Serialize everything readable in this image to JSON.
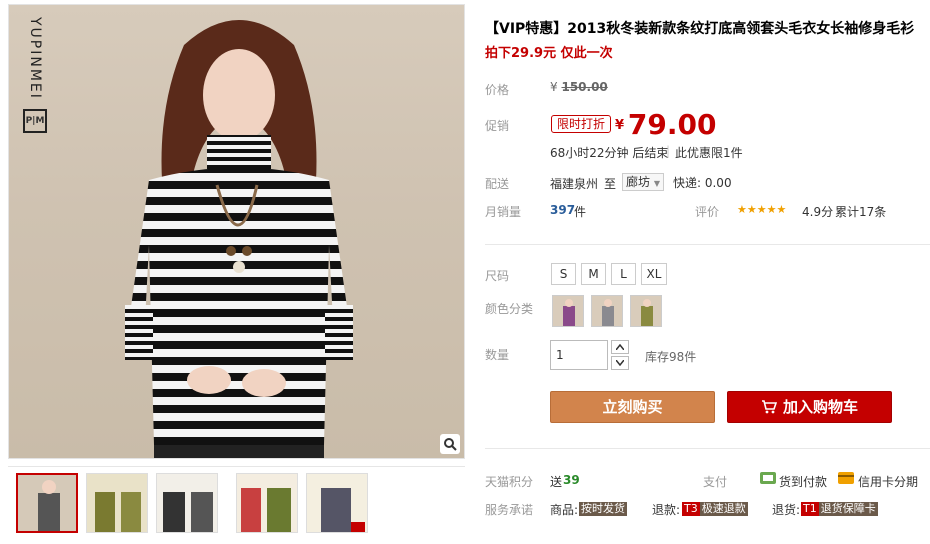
{
  "brand": {
    "name": "YUPINMEI",
    "mark": "P|M"
  },
  "product": {
    "title": "【VIP特惠】2013秋冬装新款条纹打底高领套头毛衣女长袖修身毛衫",
    "subtitle": "拍下29.9元 仅此一次"
  },
  "price": {
    "label": "价格",
    "currency": "¥",
    "original": "150.00"
  },
  "promo": {
    "label": "促销",
    "tag": "限时打折",
    "currency": "¥",
    "price": "79.00",
    "countdown": "68小时22分钟 后结束",
    "limit": "此优惠限1件"
  },
  "shipping": {
    "label": "配送",
    "from": "福建泉州",
    "to_word": "至",
    "to": "廊坊",
    "fee": "快递: 0.00"
  },
  "sales": {
    "label": "月销量",
    "count": "397",
    "unit": "件",
    "rating_label": "评价",
    "stars": "★★★★★",
    "score": "4.9分",
    "reviews": "累计17条"
  },
  "size": {
    "label": "尺码",
    "options": [
      "S",
      "M",
      "L",
      "XL"
    ]
  },
  "color": {
    "label": "颜色分类",
    "options": [
      "purple-swatch",
      "gray-swatch",
      "olive-swatch"
    ],
    "colors": [
      "#8a4a8a",
      "#8a8a90",
      "#8a8a40"
    ]
  },
  "quantity": {
    "label": "数量",
    "value": "1",
    "stock": "库存98件"
  },
  "actions": {
    "buy": "立刻购买",
    "cart": "加入购物车"
  },
  "points": {
    "label": "天猫积分",
    "value_prefix": "送",
    "value": "39"
  },
  "payment": {
    "label": "支付",
    "cod": "货到付款",
    "installment": "信用卡分期"
  },
  "service": {
    "label": "服务承诺",
    "goods_label": "商品:",
    "goods_badge": "按时发货",
    "refund_label": "退款:",
    "refund_code": "T3",
    "refund_badge": "极速退款",
    "return_label": "退货:",
    "return_code": "T1",
    "return_badge": "退货保障卡"
  },
  "thumbnails": [
    "thumb-1",
    "thumb-2",
    "thumb-3",
    "thumb-4",
    "thumb-5"
  ],
  "colors_theme": {
    "accent": "#c40000",
    "buy": "#d2844c"
  }
}
